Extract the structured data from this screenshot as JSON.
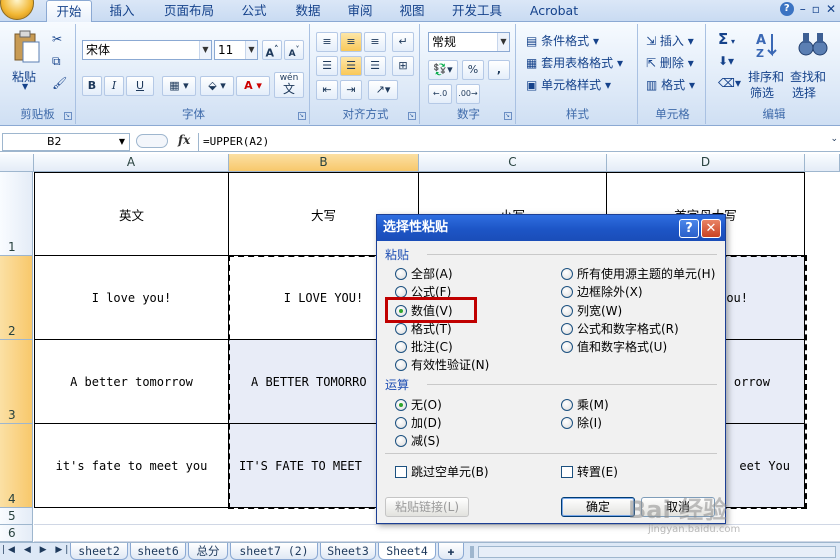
{
  "tabs": [
    "开始",
    "插入",
    "页面布局",
    "公式",
    "数据",
    "审阅",
    "视图",
    "开发工具",
    "Acrobat"
  ],
  "active_tab": "开始",
  "ribbon": {
    "clipboard": {
      "label": "剪贴板",
      "paste": "粘贴"
    },
    "font": {
      "label": "字体",
      "family": "宋体",
      "size": "11",
      "bold": "B",
      "italic": "I",
      "underline": "U",
      "wen": "wén",
      "wen_char": "文"
    },
    "alignment": {
      "label": "对齐方式"
    },
    "number": {
      "label": "数字",
      "format": "常规",
      "percent": "%",
      "comma": ","
    },
    "styles": {
      "label": "样式",
      "items": [
        "条件格式",
        "套用表格格式",
        "单元格样式"
      ]
    },
    "cells": {
      "label": "单元格",
      "items": [
        "插入",
        "删除",
        "格式"
      ]
    },
    "editing": {
      "label": "编辑",
      "sigma": "Σ",
      "sort_line1": "排序和",
      "sort_line2": "筛选",
      "find_line1": "查找和",
      "find_line2": "选择"
    }
  },
  "formula_bar": {
    "name_box": "B2",
    "fx": "fx",
    "formula": "=UPPER(A2)"
  },
  "columns": [
    "A",
    "B",
    "C",
    "D"
  ],
  "rows": [
    "1",
    "2",
    "3",
    "4",
    "5",
    "6"
  ],
  "cells": {
    "A1": "英文",
    "B1": "大写",
    "C1": "小写",
    "D1": "首字母大写",
    "A2": "I love you!",
    "B2": "I LOVE YOU!",
    "D2": "ou!",
    "A3": "A better tomorrow",
    "B3": "A BETTER TOMORRO",
    "D3": "orrow",
    "A4": "it's fate to meet you",
    "B4": "IT'S FATE TO MEET",
    "D4": "eet You"
  },
  "sheets": [
    "sheet2",
    "sheet6",
    "总分",
    "sheet7 (2)",
    "Sheet3",
    "Sheet4"
  ],
  "active_sheet": "Sheet4",
  "dialog": {
    "title": "选择性粘贴",
    "help": "?",
    "close": "✕",
    "paste_section": "粘贴",
    "paste_left": [
      "全部(A)",
      "公式(F)",
      "数值(V)",
      "格式(T)",
      "批注(C)",
      "有效性验证(N)"
    ],
    "paste_right": [
      "所有使用源主题的单元(H)",
      "边框除外(X)",
      "列宽(W)",
      "公式和数字格式(R)",
      "值和数字格式(U)"
    ],
    "paste_selected": "数值(V)",
    "op_section": "运算",
    "op_left": [
      "无(O)",
      "加(D)",
      "减(S)"
    ],
    "op_right": [
      "乘(M)",
      "除(I)"
    ],
    "op_selected": "无(O)",
    "skip_blanks": "跳过空单元(B)",
    "transpose": "转置(E)",
    "paste_link": "粘贴链接(L)",
    "ok": "确定",
    "cancel": "取消"
  },
  "watermark": {
    "brand": "Bai 经验",
    "url": "jingyan.baidu.com"
  },
  "colors": {
    "ribbon_text": "#15428b",
    "dialog_title": "#1d55c6",
    "highlight": "#c00000",
    "selected_header": "#f8c86b"
  }
}
